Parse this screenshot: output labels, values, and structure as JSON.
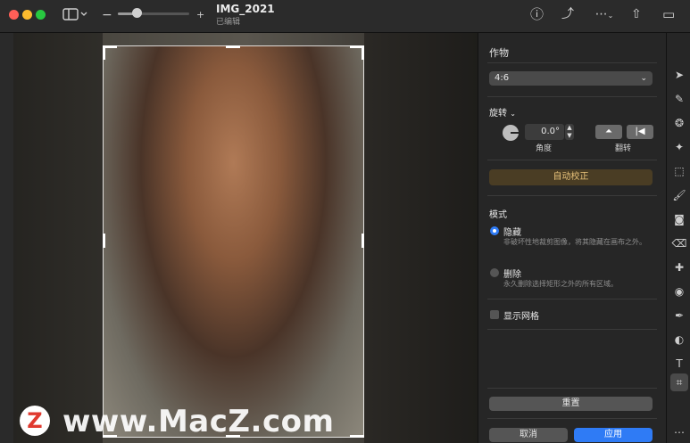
{
  "window": {
    "title": "IMG_2021",
    "subtitle": "已编辑"
  },
  "toolbar_icons": {
    "sidebar": "sidebar-icon",
    "zoom_out": "−",
    "zoom_in": "+",
    "info": "ⓘ",
    "rotate": "⤴",
    "more": "⋯",
    "share": "⇧",
    "inspector": "▭"
  },
  "panel": {
    "section_crop": "作物",
    "aspect_select": "4:6",
    "rotate_label": "旋转",
    "angle_value": "0.0°",
    "angle_label": "角度",
    "flip_label": "翻转",
    "auto_straighten": "自动校正",
    "mode_label": "模式",
    "hide_option": "隐藏",
    "hide_desc": "非破坏性地裁剪图像，将其隐藏在画布之外。",
    "delete_option": "删除",
    "delete_desc": "永久删除选择矩形之外的所有区域。",
    "show_grid": "显示网格",
    "reset": "重置",
    "cancel": "取消",
    "apply": "应用"
  },
  "watermark": {
    "logo": "Z",
    "text": "www.MacZ.com"
  },
  "colors": {
    "accent": "#2f7bf5",
    "auto_btn_text": "#e8c27a"
  }
}
